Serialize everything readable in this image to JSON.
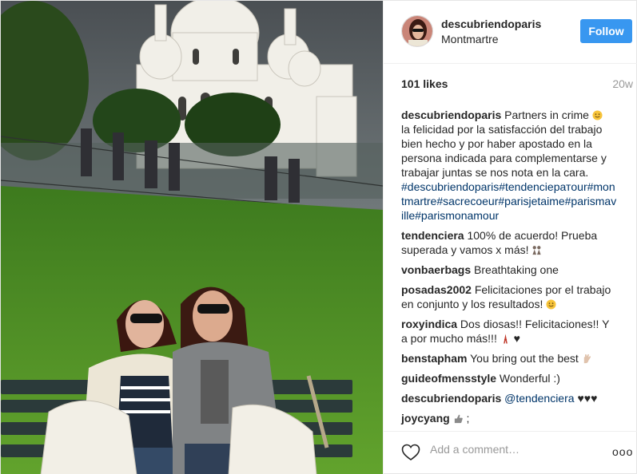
{
  "post": {
    "username": "descubriendoparis",
    "location": "Montmartre",
    "follow_label": "Follow",
    "likes": "101 likes",
    "age": "20w",
    "add_comment_placeholder": "Add a comment…",
    "more_label": "ooo"
  },
  "caption": {
    "handle": "descubriendoparis",
    "text": "Partners in crime",
    "emoji": "smile-emoji",
    "body": "la felicidad por la satisfacción del trabajo bien hecho y por haber apostado en la persona indicada para complementarse y trabajar juntas se nos nota en la cara.",
    "hashtags": "#descubriendoparis#tendenciератour#montmartre#sacrecoeur#parisjetaime#parismaville#parismonamour"
  },
  "comments": [
    {
      "handle": "tendenciera",
      "text": "100% de acuerdo! Prueba superada y vamos x más!",
      "emoji": "women-emoji"
    },
    {
      "handle": "vonbaerbags",
      "text": "Breathtaking one"
    },
    {
      "handle": "posadas2002",
      "text": "Felicitaciones por el trabajo en conjunto y los resultados!",
      "emoji": "smile-emoji"
    },
    {
      "handle": "roxyindica",
      "text": "Dos diosas!! Felicitaciones!! Y a por mucho más!!!",
      "emoji": "eiffel-heart-emoji",
      "suffix": "♥"
    },
    {
      "handle": "benstapham",
      "text": "You bring out the best",
      "emoji": "hand-emoji"
    },
    {
      "handle": "guideofmensstyle",
      "text": "Wonderful :)"
    },
    {
      "handle": "descubriendoparis",
      "mention": "@tendenciera",
      "text": "♥♥♥"
    },
    {
      "handle": "joycyang",
      "emoji": "thumb-emoji",
      "text": ";"
    }
  ],
  "colors": {
    "accent": "#3897f0",
    "hashtag": "#003569",
    "muted": "#999999",
    "text": "#262626"
  },
  "icons": {
    "heart": "heart-icon",
    "more": "more-icon"
  }
}
